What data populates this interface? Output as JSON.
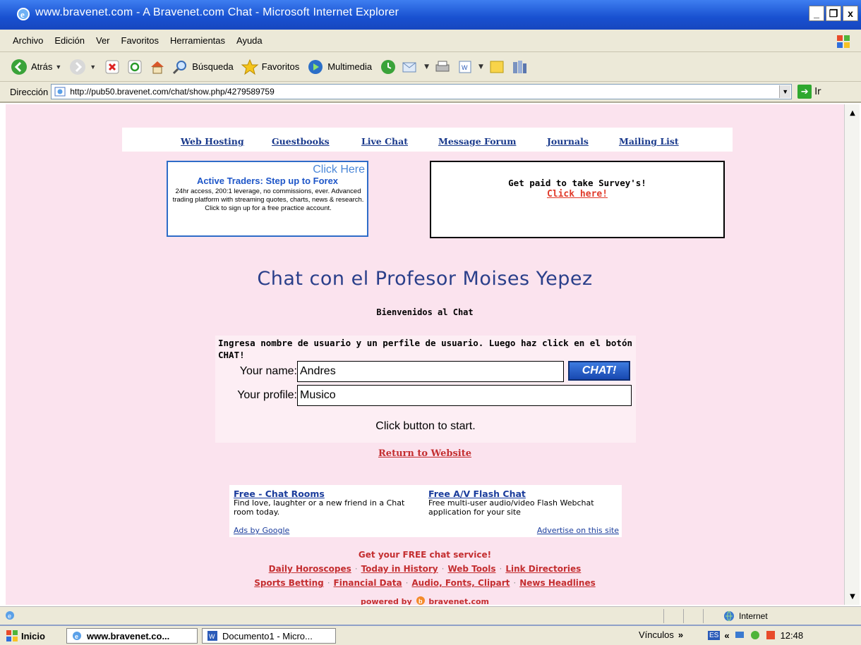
{
  "window": {
    "title": "www.bravenet.com - A Bravenet.com Chat - Microsoft Internet Explorer",
    "min": "_",
    "restore": "❐",
    "close": "x"
  },
  "menu": [
    "Archivo",
    "Edición",
    "Ver",
    "Favoritos",
    "Herramientas",
    "Ayuda"
  ],
  "toolbar": {
    "back": "Atrás",
    "search": "Búsqueda",
    "favorites": "Favoritos",
    "media": "Multimedia"
  },
  "address": {
    "label": "Dirección",
    "url": "http://pub50.bravenet.com/chat/show.php/4279589759",
    "go": "Ir"
  },
  "nav": [
    "Web Hosting",
    "Guestbooks",
    "Live Chat",
    "Message Forum",
    "Journals",
    "Mailing List"
  ],
  "ad_forex": {
    "click": "Click Here",
    "headline": "Active Traders: Step up to Forex",
    "body": "24hr access, 200:1 leverage, no commissions, ever. Advanced trading platform with streaming quotes, charts, news & research. Click to sign up for a free practice account."
  },
  "ad_survey": {
    "line1": "Get paid to take Survey's!",
    "line2": "Click here!"
  },
  "chat": {
    "title": "Chat con el Profesor Moises Yepez",
    "welcome": "Bienvenidos al Chat",
    "instructions": "Ingresa nombre de usuario y un perfile de usuario. Luego haz click en el botón CHAT!",
    "name_label": "Your name:",
    "name_value": "Andres",
    "profile_label": "Your profile:",
    "profile_value": "Musico",
    "button": "CHAT!",
    "status": "Click button to start."
  },
  "return_link": "Return to Website",
  "google_ads": {
    "ad1_title": "Free - Chat Rooms",
    "ad1_body": "Find love, laughter or a new friend in a Chat room today.",
    "ad2_title": "Free A/V Flash Chat",
    "ad2_body": "Free multi-user audio/video Flash Webchat application for your site",
    "ads_by": "Ads by Google",
    "advertise": "Advertise on this site"
  },
  "footer": {
    "free": "Get your FREE chat service!",
    "row1": [
      "Daily Horoscopes",
      "Today in History",
      "Web Tools",
      "Link Directories"
    ],
    "row2": [
      "Sports Betting",
      "Financial Data",
      "Audio, Fonts, Clipart",
      "News Headlines"
    ],
    "sep": "·",
    "powered_prefix": "powered by",
    "powered_brand": "bravenet.com"
  },
  "statusbar": {
    "zone": "Internet"
  },
  "taskbar": {
    "start": "Inicio",
    "task1": "www.bravenet.co...",
    "task2": "Documento1 - Micro...",
    "links": "Vínculos",
    "links_chevron": "»",
    "lang": "ES",
    "tray_chevron": "«",
    "clock": "12:48"
  },
  "colors": {
    "page_bg": "#fbe3ee",
    "link_blue": "#1a3a8c",
    "link_red": "#c42e30",
    "title_blue": "#2a3f8a",
    "xp_blue": "#1850d0"
  }
}
